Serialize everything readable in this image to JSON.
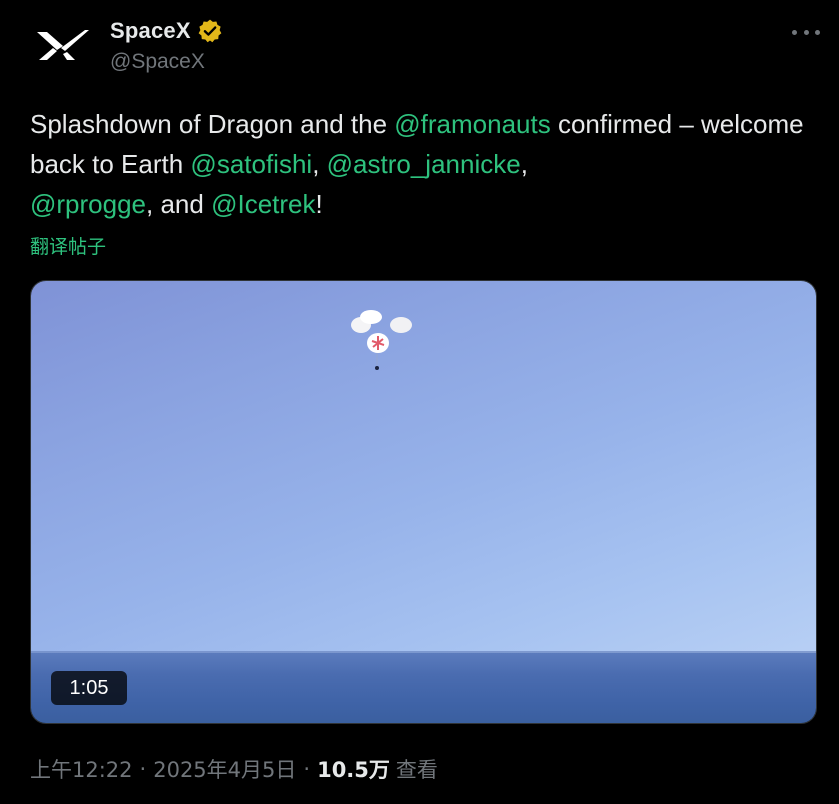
{
  "author": {
    "display_name": "SpaceX",
    "handle": "@SpaceX",
    "verified_color": "#e2b719"
  },
  "tweet": {
    "segments": [
      {
        "text": "Splashdown of Dragon and the ",
        "type": "text"
      },
      {
        "text": "@framonauts",
        "type": "mention"
      },
      {
        "text": " confirmed – welcome back to Earth ",
        "type": "text"
      },
      {
        "text": "@satofishi",
        "type": "mention"
      },
      {
        "text": ", ",
        "type": "text"
      },
      {
        "text": "@astro_jannicke",
        "type": "mention"
      },
      {
        "text": ", ",
        "type": "text"
      },
      {
        "text": "@rprogge",
        "type": "mention"
      },
      {
        "text": ", and ",
        "type": "text"
      },
      {
        "text": "@Icetrek",
        "type": "mention"
      },
      {
        "text": "!",
        "type": "text"
      }
    ],
    "translate_label": "翻译帖子"
  },
  "media": {
    "duration": "1:05"
  },
  "meta": {
    "time": "上午12:22",
    "date": "2025年4月5日",
    "views_count": "10.5万",
    "views_label": "查看"
  },
  "colors": {
    "background": "#000000",
    "text": "#e7e9ea",
    "muted": "#71767b",
    "mention": "#2ec27e"
  }
}
